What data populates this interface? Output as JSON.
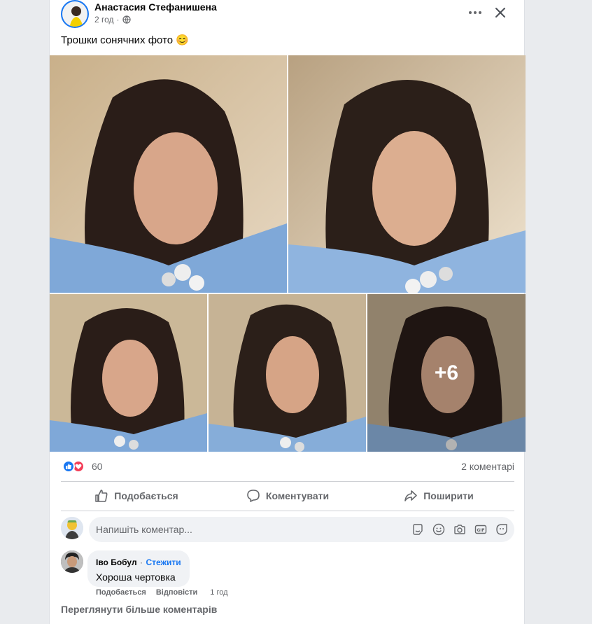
{
  "post": {
    "author": "Анастасия Стефанишена",
    "time": "2 год",
    "separator": "·",
    "text": "Трошки сонячних фото",
    "text_emoji": "😊"
  },
  "photos": {
    "more_count": "+6"
  },
  "stats": {
    "reactions_count": "60",
    "comments_count": "2 коментарі"
  },
  "actions": {
    "like": "Подобається",
    "comment": "Коментувати",
    "share": "Поширити"
  },
  "composer": {
    "placeholder": "Напишіть коментар..."
  },
  "comments": [
    {
      "author": "Іво Бобул",
      "separator": "·",
      "follow": "Стежити",
      "text": "Хороша чертовка",
      "like": "Подобається",
      "reply": "Відповісти",
      "time": "1 год"
    }
  ],
  "more_comments": "Переглянути більше коментарів",
  "colors": {
    "accent": "#1877f2",
    "love": "#f33e58",
    "muted": "#65676b",
    "input_bg": "#f0f2f5"
  },
  "icons": [
    "globe-icon",
    "more-horizontal-icon",
    "close-icon",
    "like-icon",
    "comment-icon",
    "share-icon",
    "sticker-icon",
    "emoji-icon",
    "camera-icon",
    "gif-icon",
    "avatar-sticker-icon"
  ]
}
